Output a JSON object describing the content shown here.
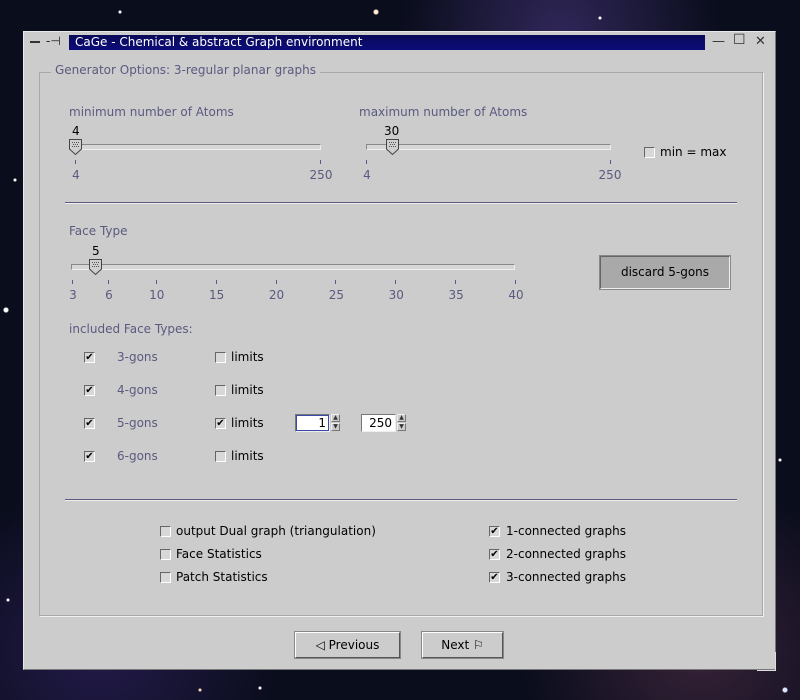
{
  "window": {
    "title": "CaGe - Chemical & abstract Graph environment",
    "pin_glyph": "-⊣",
    "minimize_glyph": "—",
    "maximize_glyph": "☐",
    "close_glyph": "✕"
  },
  "panel": {
    "legend": "Generator Options:  3-regular planar graphs"
  },
  "min_atoms": {
    "label": "minimum number of Atoms",
    "value": "4",
    "min_tick": "4",
    "max_tick": "250",
    "fraction": 0.0
  },
  "max_atoms": {
    "label": "maximum number of Atoms",
    "value": "30",
    "min_tick": "4",
    "max_tick": "250",
    "fraction": 0.106
  },
  "min_eq_max": {
    "label": "min = max",
    "checked": false
  },
  "face_type": {
    "label": "Face Type",
    "value": "5",
    "ticks": [
      "3",
      "6",
      "10",
      "15",
      "20",
      "25",
      "30",
      "35",
      "40"
    ],
    "discard_button": "discard 5-gons"
  },
  "included": {
    "label": "included Face Types:",
    "rows": [
      {
        "gon": "3-gons",
        "checked": true,
        "limits_label": "limits",
        "limits": false
      },
      {
        "gon": "4-gons",
        "checked": true,
        "limits_label": "limits",
        "limits": false
      },
      {
        "gon": "5-gons",
        "checked": true,
        "limits_label": "limits",
        "limits": true,
        "low": "1",
        "high": "250"
      },
      {
        "gon": "6-gons",
        "checked": true,
        "limits_label": "limits",
        "limits": false
      }
    ]
  },
  "options": [
    {
      "label": "output Dual graph (triangulation)",
      "checked": false
    },
    {
      "label": "Face Statistics",
      "checked": false
    },
    {
      "label": "Patch Statistics",
      "checked": false
    }
  ],
  "connectivity": [
    {
      "label": "1-connected graphs",
      "checked": true
    },
    {
      "label": "2-connected graphs",
      "checked": true
    },
    {
      "label": "3-connected graphs",
      "checked": true
    }
  ],
  "nav": {
    "previous": "Previous",
    "next": "Next"
  },
  "colors": {
    "window_bg": "#cccccc",
    "title_bar": "#0c0c7a",
    "label_text": "#5a5a80"
  }
}
